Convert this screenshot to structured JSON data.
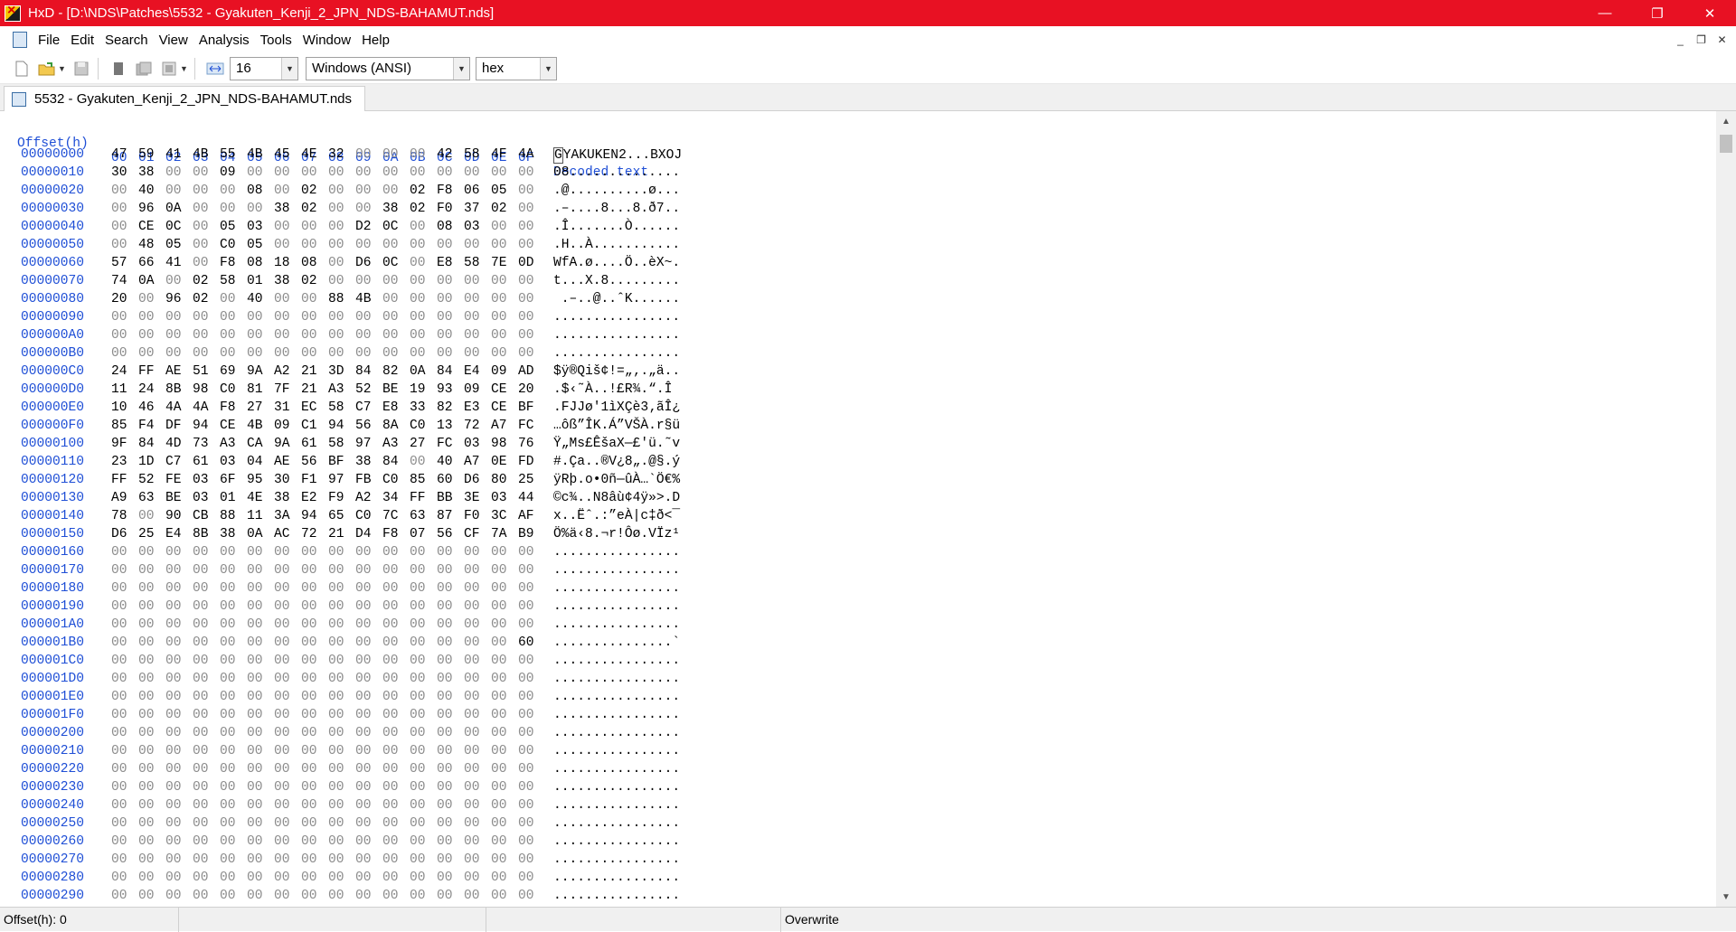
{
  "window": {
    "title": "HxD - [D:\\NDS\\Patches\\5532 - Gyakuten_Kenji_2_JPN_NDS-BAHAMUT.nds]",
    "buttons": {
      "minimize": "—",
      "restore": "❐",
      "close": "✕"
    }
  },
  "menubar": {
    "items": [
      "File",
      "Edit",
      "Search",
      "View",
      "Analysis",
      "Tools",
      "Window",
      "Help"
    ],
    "mdi": {
      "minimize": "_",
      "restore": "❐",
      "close": "✕"
    }
  },
  "toolbar": {
    "bytes_per_row": "16",
    "charset": "Windows (ANSI)",
    "offset_base": "hex",
    "icons": [
      "new-file-icon",
      "open-file-icon",
      "save-icon",
      "close-doc-icon",
      "save-all-icon",
      "properties-icon",
      "bytes-per-row-icon"
    ]
  },
  "document_tab": {
    "label": "5532 - Gyakuten_Kenji_2_JPN_NDS-BAHAMUT.nds"
  },
  "hex_header": {
    "offset": "Offset(h)",
    "columns": [
      "00",
      "01",
      "02",
      "03",
      "04",
      "05",
      "06",
      "07",
      "08",
      "09",
      "0A",
      "0B",
      "0C",
      "0D",
      "0E",
      "0F"
    ],
    "decoded": "Decoded text"
  },
  "rows": [
    {
      "offset": "00000000",
      "bytes": [
        "47",
        "59",
        "41",
        "4B",
        "55",
        "4B",
        "45",
        "4E",
        "32",
        "00",
        "00",
        "00",
        "42",
        "58",
        "4F",
        "4A"
      ],
      "text": "GYAKUKEN2...BXOJ"
    },
    {
      "offset": "00000010",
      "bytes": [
        "30",
        "38",
        "00",
        "00",
        "09",
        "00",
        "00",
        "00",
        "00",
        "00",
        "00",
        "00",
        "00",
        "00",
        "00",
        "00"
      ],
      "text": "08.............."
    },
    {
      "offset": "00000020",
      "bytes": [
        "00",
        "40",
        "00",
        "00",
        "00",
        "08",
        "00",
        "02",
        "00",
        "00",
        "00",
        "02",
        "F8",
        "06",
        "05",
        "00"
      ],
      "text": ".@..........ø..."
    },
    {
      "offset": "00000030",
      "bytes": [
        "00",
        "96",
        "0A",
        "00",
        "00",
        "00",
        "38",
        "02",
        "00",
        "00",
        "38",
        "02",
        "F0",
        "37",
        "02",
        "00"
      ],
      "text": ".–....8...8.ð7.."
    },
    {
      "offset": "00000040",
      "bytes": [
        "00",
        "CE",
        "0C",
        "00",
        "05",
        "03",
        "00",
        "00",
        "00",
        "D2",
        "0C",
        "00",
        "08",
        "03",
        "00",
        "00"
      ],
      "text": ".Î.......Ò......"
    },
    {
      "offset": "00000050",
      "bytes": [
        "00",
        "48",
        "05",
        "00",
        "C0",
        "05",
        "00",
        "00",
        "00",
        "00",
        "00",
        "00",
        "00",
        "00",
        "00",
        "00"
      ],
      "text": ".H..À..........."
    },
    {
      "offset": "00000060",
      "bytes": [
        "57",
        "66",
        "41",
        "00",
        "F8",
        "08",
        "18",
        "08",
        "00",
        "D6",
        "0C",
        "00",
        "E8",
        "58",
        "7E",
        "0D"
      ],
      "text": "WfA.ø....Ö..èX~."
    },
    {
      "offset": "00000070",
      "bytes": [
        "74",
        "0A",
        "00",
        "02",
        "58",
        "01",
        "38",
        "02",
        "00",
        "00",
        "00",
        "00",
        "00",
        "00",
        "00",
        "00"
      ],
      "text": "t...X.8........."
    },
    {
      "offset": "00000080",
      "bytes": [
        "20",
        "00",
        "96",
        "02",
        "00",
        "40",
        "00",
        "00",
        "88",
        "4B",
        "00",
        "00",
        "00",
        "00",
        "00",
        "00"
      ],
      "text": " .–..@..ˆK......"
    },
    {
      "offset": "00000090",
      "bytes": [
        "00",
        "00",
        "00",
        "00",
        "00",
        "00",
        "00",
        "00",
        "00",
        "00",
        "00",
        "00",
        "00",
        "00",
        "00",
        "00"
      ],
      "text": "................"
    },
    {
      "offset": "000000A0",
      "bytes": [
        "00",
        "00",
        "00",
        "00",
        "00",
        "00",
        "00",
        "00",
        "00",
        "00",
        "00",
        "00",
        "00",
        "00",
        "00",
        "00"
      ],
      "text": "................"
    },
    {
      "offset": "000000B0",
      "bytes": [
        "00",
        "00",
        "00",
        "00",
        "00",
        "00",
        "00",
        "00",
        "00",
        "00",
        "00",
        "00",
        "00",
        "00",
        "00",
        "00"
      ],
      "text": "................"
    },
    {
      "offset": "000000C0",
      "bytes": [
        "24",
        "FF",
        "AE",
        "51",
        "69",
        "9A",
        "A2",
        "21",
        "3D",
        "84",
        "82",
        "0A",
        "84",
        "E4",
        "09",
        "AD"
      ],
      "text": "$ÿ®Qiš¢!=„‚.„ä.."
    },
    {
      "offset": "000000D0",
      "bytes": [
        "11",
        "24",
        "8B",
        "98",
        "C0",
        "81",
        "7F",
        "21",
        "A3",
        "52",
        "BE",
        "19",
        "93",
        "09",
        "CE",
        "20"
      ],
      "text": ".$‹˜À..!£R¾.“.Î "
    },
    {
      "offset": "000000E0",
      "bytes": [
        "10",
        "46",
        "4A",
        "4A",
        "F8",
        "27",
        "31",
        "EC",
        "58",
        "C7",
        "E8",
        "33",
        "82",
        "E3",
        "CE",
        "BF"
      ],
      "text": ".FJJø'1ìXÇè3‚ãÎ¿"
    },
    {
      "offset": "000000F0",
      "bytes": [
        "85",
        "F4",
        "DF",
        "94",
        "CE",
        "4B",
        "09",
        "C1",
        "94",
        "56",
        "8A",
        "C0",
        "13",
        "72",
        "A7",
        "FC"
      ],
      "text": "…ôß”ÎK.Á”VŠÀ.r§ü"
    },
    {
      "offset": "00000100",
      "bytes": [
        "9F",
        "84",
        "4D",
        "73",
        "A3",
        "CA",
        "9A",
        "61",
        "58",
        "97",
        "A3",
        "27",
        "FC",
        "03",
        "98",
        "76"
      ],
      "text": "Ÿ„Ms£ÊšaX—£'ü.˜v"
    },
    {
      "offset": "00000110",
      "bytes": [
        "23",
        "1D",
        "C7",
        "61",
        "03",
        "04",
        "AE",
        "56",
        "BF",
        "38",
        "84",
        "00",
        "40",
        "A7",
        "0E",
        "FD"
      ],
      "text": "#.Ça..®V¿8„.@§.ý"
    },
    {
      "offset": "00000120",
      "bytes": [
        "FF",
        "52",
        "FE",
        "03",
        "6F",
        "95",
        "30",
        "F1",
        "97",
        "FB",
        "C0",
        "85",
        "60",
        "D6",
        "80",
        "25"
      ],
      "text": "ÿRþ.o•0ñ—ûÀ…`Ö€%"
    },
    {
      "offset": "00000130",
      "bytes": [
        "A9",
        "63",
        "BE",
        "03",
        "01",
        "4E",
        "38",
        "E2",
        "F9",
        "A2",
        "34",
        "FF",
        "BB",
        "3E",
        "03",
        "44"
      ],
      "text": "©c¾..N8âù¢4ÿ»>.D"
    },
    {
      "offset": "00000140",
      "bytes": [
        "78",
        "00",
        "90",
        "CB",
        "88",
        "11",
        "3A",
        "94",
        "65",
        "C0",
        "7C",
        "63",
        "87",
        "F0",
        "3C",
        "AF"
      ],
      "text": "x..Ëˆ.:”eÀ|c‡ð<¯"
    },
    {
      "offset": "00000150",
      "bytes": [
        "D6",
        "25",
        "E4",
        "8B",
        "38",
        "0A",
        "AC",
        "72",
        "21",
        "D4",
        "F8",
        "07",
        "56",
        "CF",
        "7A",
        "B9"
      ],
      "text": "Ö%ä‹8.¬r!Ôø.VÏz¹"
    },
    {
      "offset": "00000160",
      "bytes": [
        "00",
        "00",
        "00",
        "00",
        "00",
        "00",
        "00",
        "00",
        "00",
        "00",
        "00",
        "00",
        "00",
        "00",
        "00",
        "00"
      ],
      "text": "................"
    },
    {
      "offset": "00000170",
      "bytes": [
        "00",
        "00",
        "00",
        "00",
        "00",
        "00",
        "00",
        "00",
        "00",
        "00",
        "00",
        "00",
        "00",
        "00",
        "00",
        "00"
      ],
      "text": "................"
    },
    {
      "offset": "00000180",
      "bytes": [
        "00",
        "00",
        "00",
        "00",
        "00",
        "00",
        "00",
        "00",
        "00",
        "00",
        "00",
        "00",
        "00",
        "00",
        "00",
        "00"
      ],
      "text": "................"
    },
    {
      "offset": "00000190",
      "bytes": [
        "00",
        "00",
        "00",
        "00",
        "00",
        "00",
        "00",
        "00",
        "00",
        "00",
        "00",
        "00",
        "00",
        "00",
        "00",
        "00"
      ],
      "text": "................"
    },
    {
      "offset": "000001A0",
      "bytes": [
        "00",
        "00",
        "00",
        "00",
        "00",
        "00",
        "00",
        "00",
        "00",
        "00",
        "00",
        "00",
        "00",
        "00",
        "00",
        "00"
      ],
      "text": "................"
    },
    {
      "offset": "000001B0",
      "bytes": [
        "00",
        "00",
        "00",
        "00",
        "00",
        "00",
        "00",
        "00",
        "00",
        "00",
        "00",
        "00",
        "00",
        "00",
        "00",
        "60"
      ],
      "text": "...............`"
    },
    {
      "offset": "000001C0",
      "bytes": [
        "00",
        "00",
        "00",
        "00",
        "00",
        "00",
        "00",
        "00",
        "00",
        "00",
        "00",
        "00",
        "00",
        "00",
        "00",
        "00"
      ],
      "text": "................"
    },
    {
      "offset": "000001D0",
      "bytes": [
        "00",
        "00",
        "00",
        "00",
        "00",
        "00",
        "00",
        "00",
        "00",
        "00",
        "00",
        "00",
        "00",
        "00",
        "00",
        "00"
      ],
      "text": "................"
    },
    {
      "offset": "000001E0",
      "bytes": [
        "00",
        "00",
        "00",
        "00",
        "00",
        "00",
        "00",
        "00",
        "00",
        "00",
        "00",
        "00",
        "00",
        "00",
        "00",
        "00"
      ],
      "text": "................"
    },
    {
      "offset": "000001F0",
      "bytes": [
        "00",
        "00",
        "00",
        "00",
        "00",
        "00",
        "00",
        "00",
        "00",
        "00",
        "00",
        "00",
        "00",
        "00",
        "00",
        "00"
      ],
      "text": "................"
    },
    {
      "offset": "00000200",
      "bytes": [
        "00",
        "00",
        "00",
        "00",
        "00",
        "00",
        "00",
        "00",
        "00",
        "00",
        "00",
        "00",
        "00",
        "00",
        "00",
        "00"
      ],
      "text": "................"
    },
    {
      "offset": "00000210",
      "bytes": [
        "00",
        "00",
        "00",
        "00",
        "00",
        "00",
        "00",
        "00",
        "00",
        "00",
        "00",
        "00",
        "00",
        "00",
        "00",
        "00"
      ],
      "text": "................"
    },
    {
      "offset": "00000220",
      "bytes": [
        "00",
        "00",
        "00",
        "00",
        "00",
        "00",
        "00",
        "00",
        "00",
        "00",
        "00",
        "00",
        "00",
        "00",
        "00",
        "00"
      ],
      "text": "................"
    },
    {
      "offset": "00000230",
      "bytes": [
        "00",
        "00",
        "00",
        "00",
        "00",
        "00",
        "00",
        "00",
        "00",
        "00",
        "00",
        "00",
        "00",
        "00",
        "00",
        "00"
      ],
      "text": "................"
    },
    {
      "offset": "00000240",
      "bytes": [
        "00",
        "00",
        "00",
        "00",
        "00",
        "00",
        "00",
        "00",
        "00",
        "00",
        "00",
        "00",
        "00",
        "00",
        "00",
        "00"
      ],
      "text": "................"
    },
    {
      "offset": "00000250",
      "bytes": [
        "00",
        "00",
        "00",
        "00",
        "00",
        "00",
        "00",
        "00",
        "00",
        "00",
        "00",
        "00",
        "00",
        "00",
        "00",
        "00"
      ],
      "text": "................"
    },
    {
      "offset": "00000260",
      "bytes": [
        "00",
        "00",
        "00",
        "00",
        "00",
        "00",
        "00",
        "00",
        "00",
        "00",
        "00",
        "00",
        "00",
        "00",
        "00",
        "00"
      ],
      "text": "................"
    },
    {
      "offset": "00000270",
      "bytes": [
        "00",
        "00",
        "00",
        "00",
        "00",
        "00",
        "00",
        "00",
        "00",
        "00",
        "00",
        "00",
        "00",
        "00",
        "00",
        "00"
      ],
      "text": "................"
    },
    {
      "offset": "00000280",
      "bytes": [
        "00",
        "00",
        "00",
        "00",
        "00",
        "00",
        "00",
        "00",
        "00",
        "00",
        "00",
        "00",
        "00",
        "00",
        "00",
        "00"
      ],
      "text": "................"
    },
    {
      "offset": "00000290",
      "bytes": [
        "00",
        "00",
        "00",
        "00",
        "00",
        "00",
        "00",
        "00",
        "00",
        "00",
        "00",
        "00",
        "00",
        "00",
        "00",
        "00"
      ],
      "text": "................"
    }
  ],
  "statusbar": {
    "offset": "Offset(h): 0",
    "mode": "Overwrite"
  },
  "colors": {
    "titlebar": "#e81123",
    "offset_text": "#1f4fd6",
    "zero_byte": "#8c8c8c"
  }
}
